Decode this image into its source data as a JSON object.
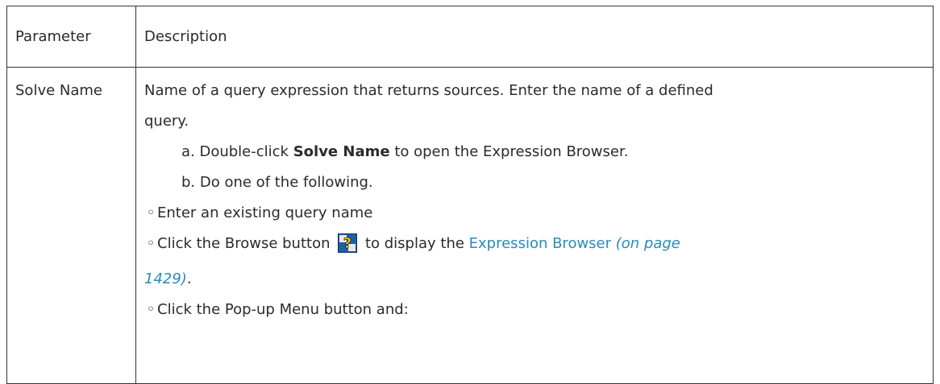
{
  "table": {
    "header": {
      "parameter": "Parameter",
      "description": "Description"
    },
    "row": {
      "parameter": "Solve Name",
      "description_line1": "Name of a query expression that returns sources. Enter the name  of a defined",
      "description_line2": "query.",
      "step_a_prefix": "a. Double-click ",
      "step_a_bold": "Solve Name",
      "step_a_suffix": " to open the Expression Browser.",
      "step_b": "b. Do one of the following.",
      "bullet_mark": "◦",
      "bullet1": "Enter an existing query name",
      "bullet2_prefix": "Click the Browse button ",
      "bullet2_mid": " to display the ",
      "bullet2_link": "Expression Browser",
      "bullet2_link_page": " (on page",
      "bullet2_link_page2": "1429)",
      "bullet2_end": ".",
      "bullet3": "Click the Pop-up Menu button and:"
    }
  },
  "icons": {
    "browse": "browse-query-icon"
  },
  "colors": {
    "link": "#2a8bb8",
    "border": "#333333",
    "text": "#2b2b2b"
  }
}
